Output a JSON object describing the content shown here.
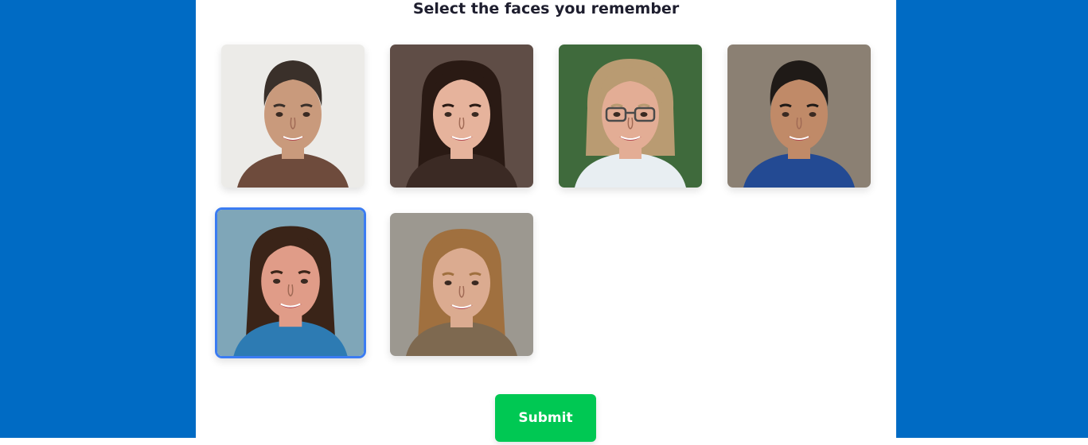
{
  "page": {
    "title": "Select the faces you remember",
    "submit_label": "Submit",
    "colors": {
      "background": "#006bc4",
      "selection": "#3b7cf2",
      "submit": "#00c853"
    }
  },
  "faces": [
    {
      "id": "face-1",
      "name": "face-photo-1",
      "selected": false,
      "bg": "#ecebe8",
      "skin": "#c99a7c",
      "hair": "#3a302a",
      "shirt": "#6e4b3c",
      "hair_style": "short",
      "glasses": false
    },
    {
      "id": "face-2",
      "name": "face-photo-2",
      "selected": false,
      "bg": "#5f4d46",
      "skin": "#e6b39c",
      "hair": "#2a1a14",
      "shirt": "#3b2a24",
      "hair_style": "long",
      "glasses": false
    },
    {
      "id": "face-3",
      "name": "face-photo-3",
      "selected": false,
      "bg": "#3f6a3c",
      "skin": "#e3ad95",
      "hair": "#b99b72",
      "shirt": "#e8eef2",
      "hair_style": "bob",
      "glasses": true
    },
    {
      "id": "face-4",
      "name": "face-photo-4",
      "selected": false,
      "bg": "#8b8073",
      "skin": "#c08a68",
      "hair": "#1f1a17",
      "shirt": "#234a93",
      "hair_style": "short",
      "glasses": false
    },
    {
      "id": "face-5",
      "name": "face-photo-5",
      "selected": true,
      "bg": "#7fa6b8",
      "skin": "#e09c88",
      "hair": "#3a2418",
      "shirt": "#2d7bb3",
      "hair_style": "long",
      "glasses": false
    },
    {
      "id": "face-6",
      "name": "face-photo-6",
      "selected": false,
      "bg": "#9c9890",
      "skin": "#dbab90",
      "hair": "#a0703f",
      "shirt": "#7e6950",
      "hair_style": "long",
      "glasses": false
    }
  ]
}
